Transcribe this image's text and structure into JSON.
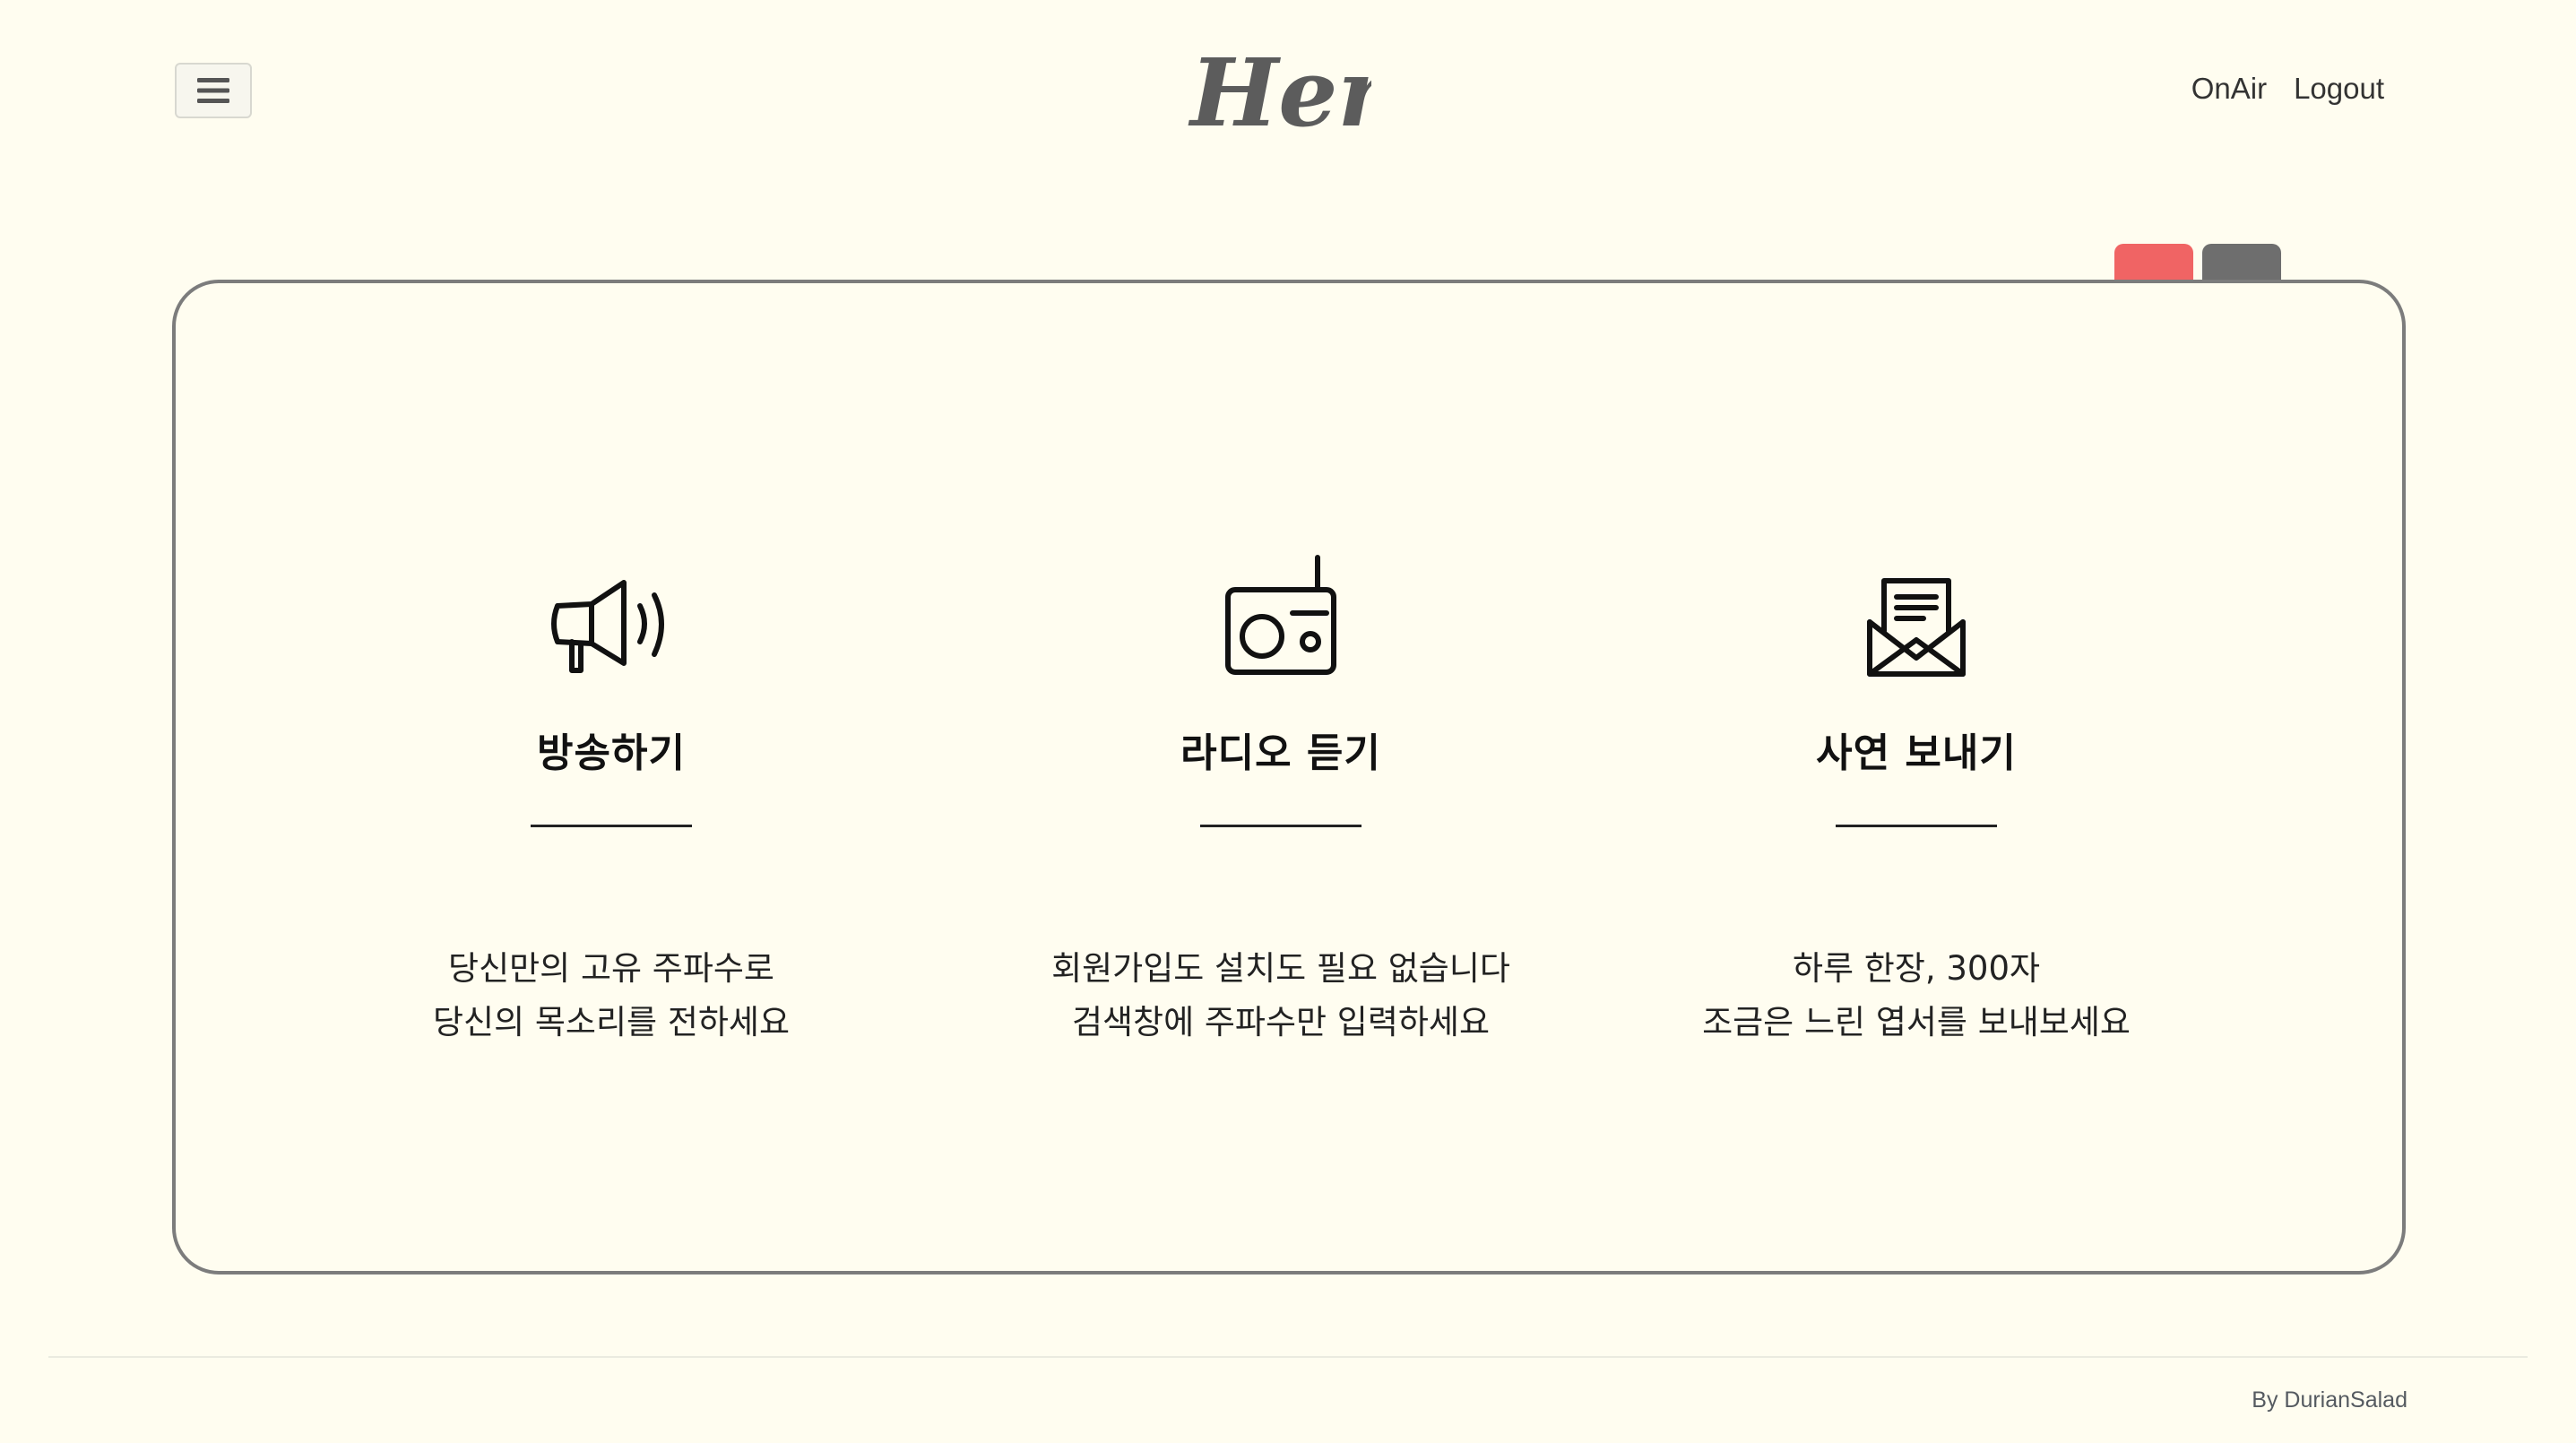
{
  "header": {
    "logo_text": "Hertz",
    "nav": [
      {
        "label": "OnAir"
      },
      {
        "label": "Logout"
      }
    ]
  },
  "icons": {
    "menu": "hamburger-menu-icon",
    "broadcast": "megaphone-icon",
    "listen": "radio-icon",
    "letter": "envelope-letter-icon"
  },
  "colors": {
    "background": "#fffdf0",
    "tab_red": "#f06464",
    "tab_gray": "#6e6e6e",
    "card_border": "#7c7c7c"
  },
  "features": [
    {
      "title": "방송하기",
      "desc_line1": "당신만의 고유 주파수로",
      "desc_line2": "당신의 목소리를 전하세요"
    },
    {
      "title": "라디오 듣기",
      "desc_line1": "회원가입도 설치도 필요 없습니다",
      "desc_line2": "검색창에 주파수만 입력하세요"
    },
    {
      "title": "사연 보내기",
      "desc_line1": "하루 한장, 300자",
      "desc_line2": "조금은 느린 엽서를 보내보세요"
    }
  ],
  "footer": {
    "credit": "By DurianSalad"
  }
}
